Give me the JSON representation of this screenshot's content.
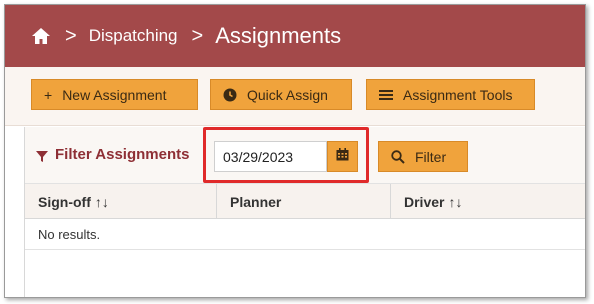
{
  "breadcrumb": {
    "home_icon": "home-icon",
    "separator": ">",
    "items": [
      "Dispatching"
    ],
    "current": "Assignments"
  },
  "toolbar": {
    "buttons": [
      {
        "icon": "plus-icon",
        "glyph": "+",
        "label": "New Assignment"
      },
      {
        "icon": "clock-icon",
        "label": "Quick Assign"
      },
      {
        "icon": "menu-icon",
        "label": "Assignment Tools"
      }
    ]
  },
  "filter": {
    "title": "Filter Assignments",
    "date_value": "03/29/2023",
    "filter_button_label": "Filter"
  },
  "table": {
    "columns": [
      {
        "label": "Sign-off",
        "sort": "↑↓"
      },
      {
        "label": "Planner",
        "sort": ""
      },
      {
        "label": "Driver",
        "sort": "↑↓"
      }
    ],
    "empty_message": "No results."
  },
  "colors": {
    "header_bg": "#a3494a",
    "button_bg": "#f0a33c",
    "filter_title": "#8e2f35",
    "highlight": "#e02a2a"
  }
}
